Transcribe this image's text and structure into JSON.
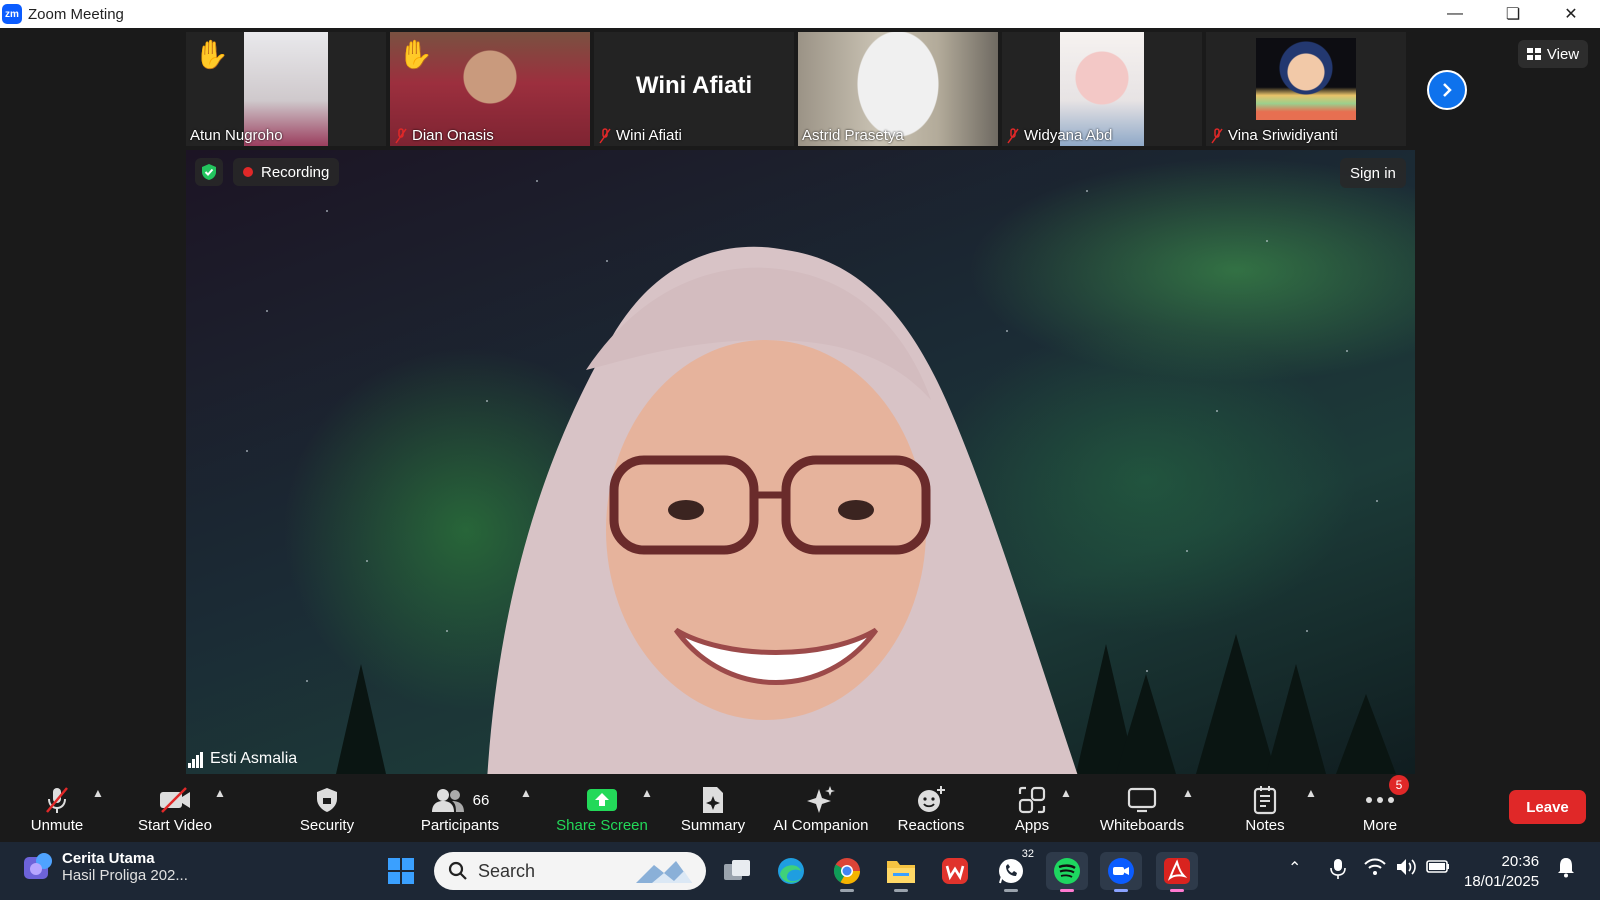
{
  "window": {
    "app_logo": "zm",
    "title": "Zoom Meeting"
  },
  "thumbnails": [
    {
      "name": "Atun Nugroho",
      "hand_raised": true,
      "muted": false,
      "type": "video"
    },
    {
      "name": "Dian Onasis",
      "hand_raised": true,
      "muted": true,
      "type": "video"
    },
    {
      "name": "Wini Afiati",
      "hand_raised": false,
      "muted": true,
      "type": "name-only",
      "big_label": "Wini Afiati"
    },
    {
      "name": "Astrid Prasetya",
      "hand_raised": false,
      "muted": false,
      "type": "video"
    },
    {
      "name": "Widyana Abd",
      "hand_raised": false,
      "muted": true,
      "type": "video"
    },
    {
      "name": "Vina Sriwidiyanti",
      "hand_raised": false,
      "muted": true,
      "type": "video"
    }
  ],
  "view_button": "View",
  "recording_label": "Recording",
  "sign_in_label": "Sign in",
  "active_speaker": "Esti Asmalia",
  "toolbar": {
    "unmute": "Unmute",
    "start_video": "Start Video",
    "security": "Security",
    "participants": "Participants",
    "participants_count": "66",
    "share_screen": "Share Screen",
    "summary": "Summary",
    "ai_companion": "AI Companion",
    "reactions": "Reactions",
    "apps": "Apps",
    "whiteboards": "Whiteboards",
    "notes": "Notes",
    "more": "More",
    "more_badge": "5",
    "leave": "Leave"
  },
  "taskbar": {
    "news_title": "Cerita Utama",
    "news_sub": "Hasil Proliga 202...",
    "search_placeholder": "Search",
    "whatsapp_badge": "32",
    "time": "20:36",
    "date": "18/01/2025"
  },
  "colors": {
    "accent": "#0e72ed",
    "share_green": "#23d959",
    "leave_red": "#e02828",
    "taskbar": "#1d2735"
  }
}
